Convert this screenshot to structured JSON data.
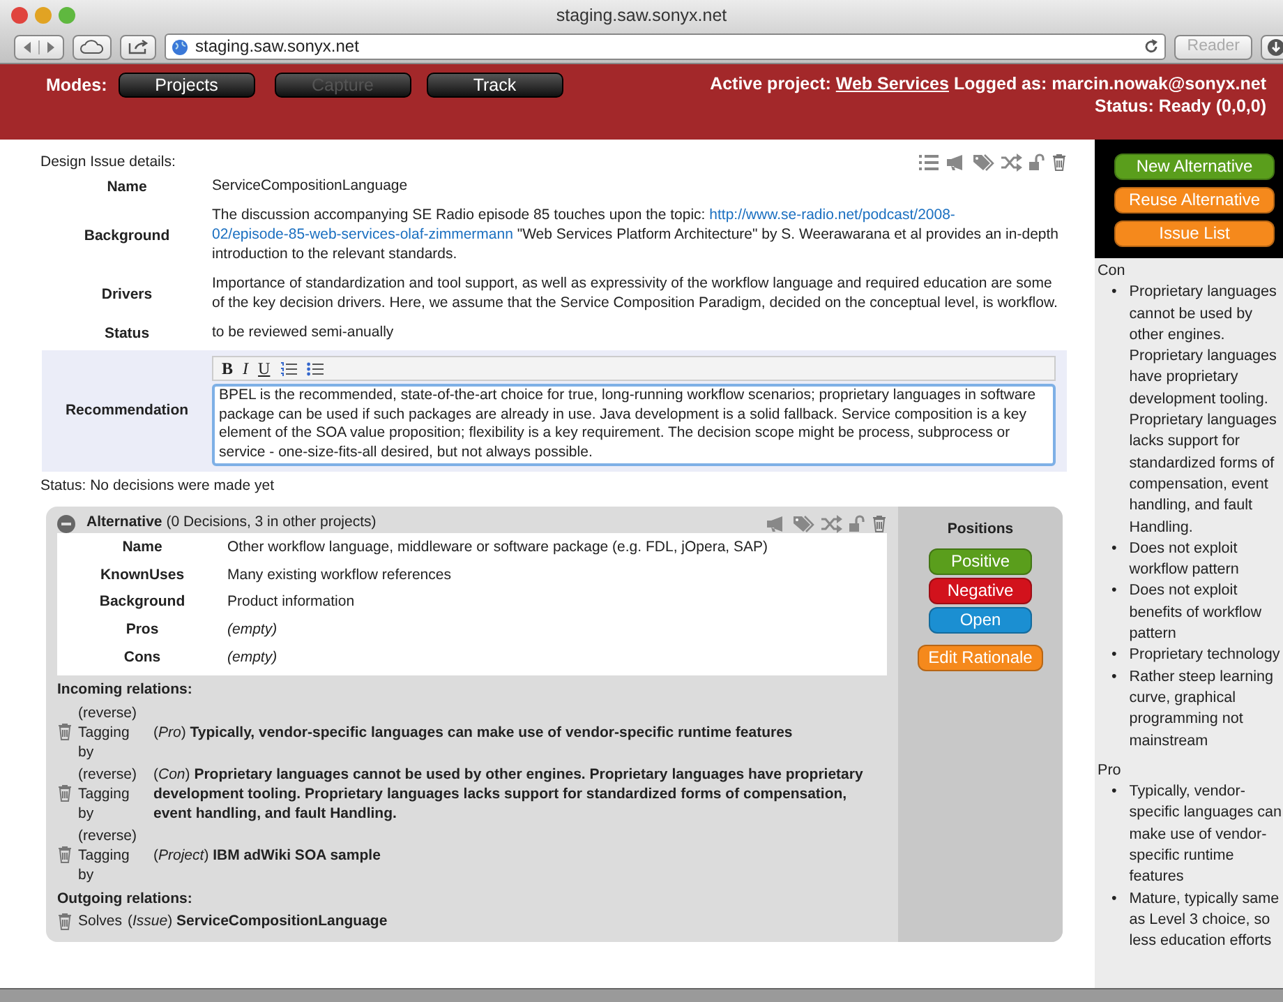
{
  "browser": {
    "title": "staging.saw.sonyx.net",
    "url": "staging.saw.sonyx.net",
    "reader": "Reader"
  },
  "header": {
    "modes_label": "Modes:",
    "modes": [
      {
        "label": "Projects",
        "disabled": false
      },
      {
        "label": "Capture",
        "disabled": true
      },
      {
        "label": "Track",
        "disabled": false
      }
    ],
    "project_label": "Active project:",
    "project": "Web Services",
    "logged": "Logged as: marcin.nowak@sonyx.net",
    "status": "Status: Ready (0,0,0)"
  },
  "issue": {
    "heading": "Design Issue details:",
    "fields": [
      {
        "kind": "text",
        "label": "Name",
        "value": "ServiceCompositionLanguage"
      },
      {
        "kind": "link",
        "label": "Background",
        "before": "The discussion accompanying SE Radio episode 85 touches upon the topic:",
        "link_parts": [
          "http://www.se-radio.net/podcast/2008-",
          "02/episode-85-web-services-olaf-zimmermann"
        ],
        "after": "\"Web Services Platform Architecture\" by S. Weerawarana et al provides an in-depth introduction to the relevant standards."
      },
      {
        "kind": "text",
        "label": "Drivers",
        "value": "Importance of standardization and tool support, as well as expressivity of the workflow language and required education are some of the key decision drivers. Here, we assume that the Service Composition Paradigm, decided on the conceptual level, is workflow."
      },
      {
        "kind": "text",
        "label": "Status",
        "value": "to be reviewed semi-anually"
      },
      {
        "kind": "editor",
        "label": "Recommendation",
        "tools": [
          "B",
          "I",
          "U"
        ],
        "value": "BPEL is the recommended, state-of-the-art choice for true, long-running workflow scenarios; proprietary languages in software package can be used if such packages are already in use. Java development is a solid fallback. Service composition is a key element of the SOA value proposition; flexibility is a key requirement. The decision scope might be process, subprocess or service - one-size-fits-all desired, but not always possible."
      }
    ],
    "status": "Status: No decisions were made yet"
  },
  "alternative": {
    "expanded": true,
    "title": "**Alternative** (0 Decisions, 3 in other projects)",
    "fields": [
      {
        "label": "Name",
        "value": "Other workflow language, middleware or software package (e.g. FDL, jOpera, SAP)",
        "empty": false
      },
      {
        "label": "KnownUses",
        "value": "Many existing workflow references",
        "empty": false
      },
      {
        "label": "Background",
        "value": "Product information",
        "empty": false
      },
      {
        "label": "Pros",
        "value": "(empty)",
        "empty": true
      },
      {
        "label": "Cons",
        "value": "(empty)",
        "empty": true
      }
    ],
    "incoming_heading": "Incoming relations:",
    "incoming": [
      {
        "relation": "(reverse) Tagging by",
        "description": "(*Pro*) **Typically, vendor-specific languages can make use of vendor-specific runtime features**"
      },
      {
        "relation": "(reverse) Tagging by",
        "description": "(*Con*) **Proprietary languages cannot be used by other engines. Proprietary languages have proprietary development tooling. Proprietary languages lacks support for standardized forms of compensation, event handling, and fault Handling.**"
      },
      {
        "relation": "(reverse) Tagging by",
        "description": "(*Project*) **IBM adWiki SOA sample**"
      }
    ],
    "outgoing_heading": "Outgoing relations:",
    "outgoing": [
      {
        "relation": "Solves",
        "description": "(*Issue*) **ServiceCompositionLanguage**"
      }
    ],
    "positions_title": "Positions",
    "positions": [
      {
        "label": "Positive",
        "color": "#5a9e1c"
      },
      {
        "label": "Negative",
        "color": "#d2121c"
      },
      {
        "label": "Open",
        "color": "#1b8fd2"
      },
      {
        "label": "Edit Rationale",
        "color": "#f5891c"
      }
    ]
  },
  "sidebar": {
    "buttons": [
      {
        "label": "New Alternative",
        "color": "#5a9e1c"
      },
      {
        "label": "Reuse Alternative",
        "color": "#f5891c"
      },
      {
        "label": "Issue List",
        "color": "#f5891c"
      }
    ],
    "sections": [
      {
        "title": "Con",
        "marker": "•",
        "items": [
          "Proprietary languages cannot be used by other engines. Proprietary languages have proprietary development tooling. Proprietary languages lacks support for standardized forms of compensation, event handling, and fault Handling.",
          "Does not exploit workflow pattern",
          "Does not exploit benefits of workflow pattern",
          "Proprietary technology",
          "Rather steep learning curve, graphical programming not mainstream"
        ]
      },
      {
        "title": "Pro",
        "marker": "•",
        "items": [
          "Typically, vendor-specific languages can make use of vendor-specific runtime features",
          "Mature, typically same as Level 3 choice, so less education efforts"
        ]
      }
    ]
  }
}
